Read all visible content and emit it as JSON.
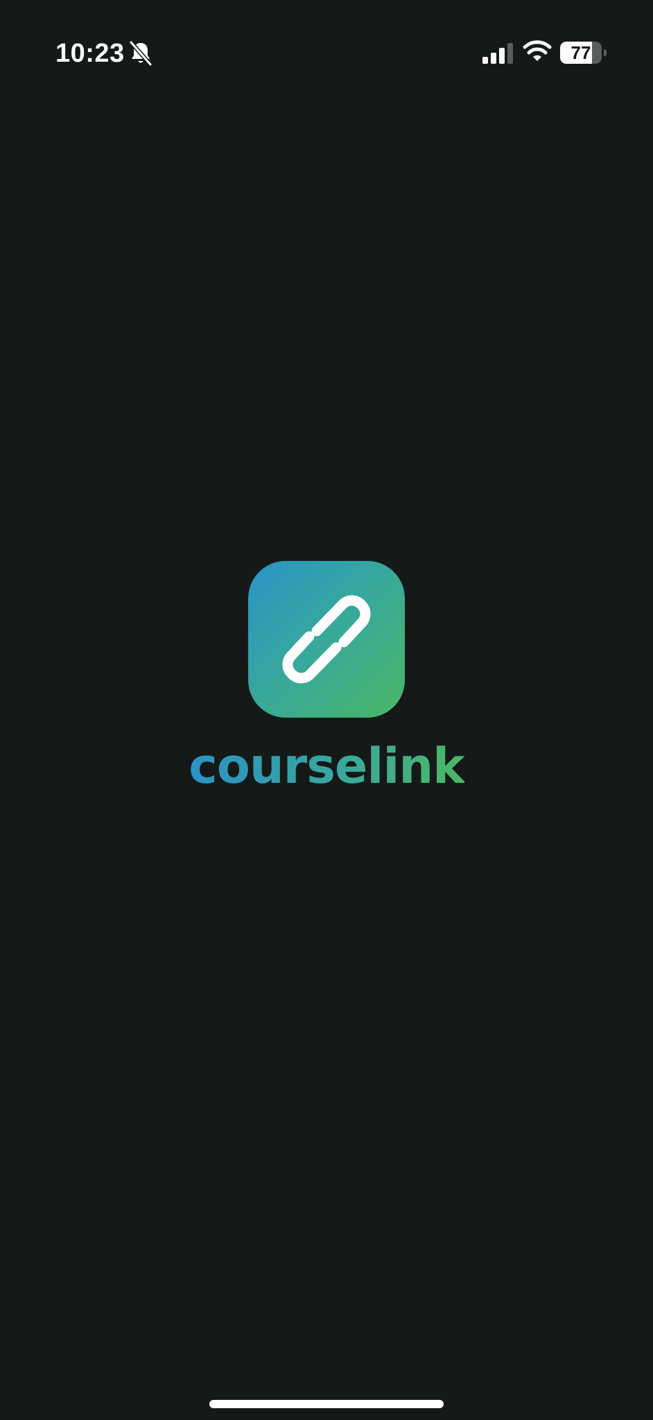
{
  "status_bar": {
    "time": "10:23",
    "bell_icon": "bell-slash-icon",
    "signal_icon": "cellular-signal-icon",
    "wifi_icon": "wifi-icon",
    "battery_level": "77",
    "battery_fraction": 0.77
  },
  "splash": {
    "logo_icon": "chain-link-icon",
    "brand_name": "courselink",
    "colors": {
      "background": "#151918",
      "gradient_start": "#2a93c7",
      "gradient_end": "#4ab763"
    }
  }
}
